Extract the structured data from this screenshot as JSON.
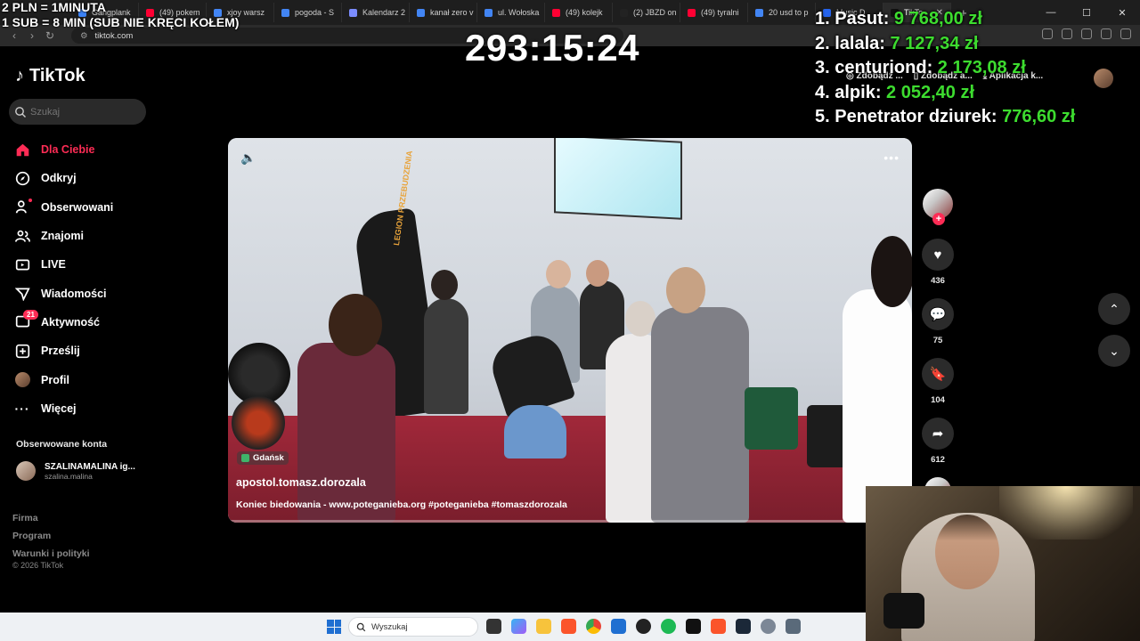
{
  "overlay": {
    "line1": "2 PLN = 1MINUTA",
    "line2": "1 SUB = 8 MIN (SUB NIE KRĘCI KOŁEM)",
    "timer": "293:15:24",
    "leaderboard": [
      {
        "name": "1. Pasut:",
        "amount": "9 768,00 zł"
      },
      {
        "name": "2. lalala:",
        "amount": "7 127,34 zł"
      },
      {
        "name": "3. centuriond:",
        "amount": "2 173,08 zł"
      },
      {
        "name": "4. alpik:",
        "amount": "2 052,40 zł"
      },
      {
        "name": "5. Penetrator dziurek:",
        "amount": "776,60 zł"
      }
    ]
  },
  "browser": {
    "tabs": [
      {
        "title": "Gangplank",
        "color": "#3b82f6"
      },
      {
        "title": "(49) pokem",
        "color": "#ff0033"
      },
      {
        "title": "xjoy warsz",
        "color": "#4285f4"
      },
      {
        "title": "pogoda - S",
        "color": "#4285f4"
      },
      {
        "title": "Kalendarz 2",
        "color": "#7b8cff"
      },
      {
        "title": "kanał zero v",
        "color": "#4285f4"
      },
      {
        "title": "ul. Wołoska",
        "color": "#4285f4"
      },
      {
        "title": "(49) kolejk",
        "color": "#ff0033"
      },
      {
        "title": "(2) JBZD on",
        "color": "#222222"
      },
      {
        "title": "(49) tyralni",
        "color": "#ff0033"
      },
      {
        "title": "20 usd to p",
        "color": "#4285f4"
      },
      {
        "title": "Music D",
        "color": "#2563eb"
      },
      {
        "title": "TikTo",
        "color": "#111111"
      }
    ],
    "url": "tiktok.com"
  },
  "tiktok": {
    "logo": "TikTok",
    "search_placeholder": "Szukaj",
    "nav": [
      {
        "label": "Dla Ciebie",
        "icon": "home-icon"
      },
      {
        "label": "Odkryj",
        "icon": "compass-icon"
      },
      {
        "label": "Obserwowani",
        "icon": "following-icon"
      },
      {
        "label": "Znajomi",
        "icon": "friends-icon"
      },
      {
        "label": "LIVE",
        "icon": "live-icon"
      },
      {
        "label": "Wiadomości",
        "icon": "messages-icon"
      },
      {
        "label": "Aktywność",
        "icon": "activity-icon",
        "badge": "21"
      },
      {
        "label": "Prześlij",
        "icon": "upload-icon"
      },
      {
        "label": "Profil",
        "icon": "profile-icon"
      },
      {
        "label": "Więcej",
        "icon": "more-icon"
      }
    ],
    "followed_title": "Obserwowane konta",
    "followed_account": {
      "name": "SZALINAMALINA ig...",
      "handle": "szalina.malina"
    },
    "footer": [
      "Firma",
      "Program",
      "Warunki i polityki"
    ],
    "copyright": "© 2026 TikTok",
    "top_buttons": [
      "Zdobądź ...",
      "Zdobądź a...",
      "Aplikacja k..."
    ],
    "video": {
      "location": "Gdańsk",
      "author": "apostol.tomasz.dorozala",
      "description": "Koniec biedowania - www.poteganieba.org #poteganieba #tomaszdorozala",
      "banner_text": "LEGION PRZEBUDZENIA"
    },
    "actions": {
      "likes": "436",
      "comments": "75",
      "saves": "104",
      "shares": "612"
    }
  },
  "taskbar": {
    "search_placeholder": "Wyszukaj"
  },
  "colors": {
    "accent": "#fe2c55",
    "leaderboard_amount": "#3ddc2f"
  }
}
